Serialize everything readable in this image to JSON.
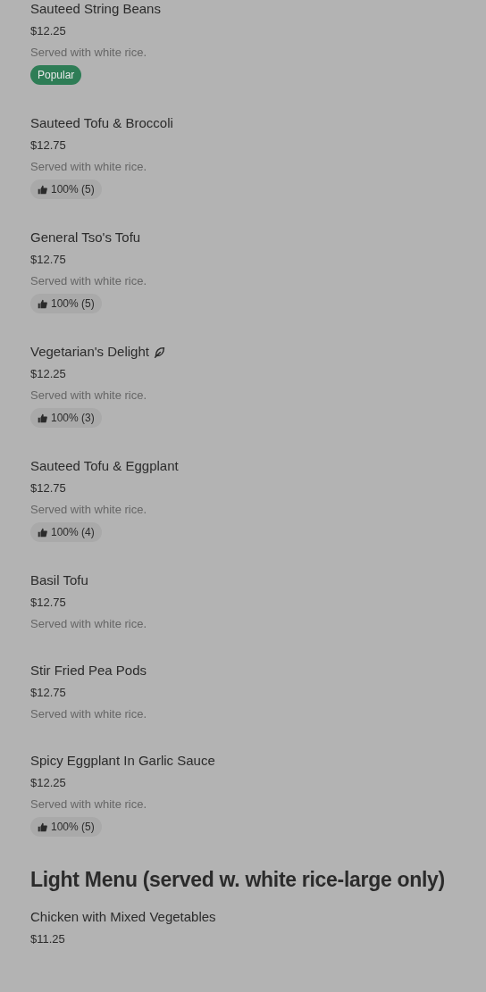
{
  "items": [
    {
      "name": "Sauteed String Beans",
      "vegetarian": false,
      "price": "$12.25",
      "description": "Served with white rice.",
      "badge": {
        "kind": "popular",
        "text": "Popular"
      }
    },
    {
      "name": "Sauteed Tofu & Broccoli",
      "vegetarian": false,
      "price": "$12.75",
      "description": "Served with white rice.",
      "badge": {
        "kind": "rating",
        "text": "100% (5)"
      }
    },
    {
      "name": "General Tso's Tofu",
      "vegetarian": false,
      "price": "$12.75",
      "description": "Served with white rice.",
      "badge": {
        "kind": "rating",
        "text": "100% (5)"
      }
    },
    {
      "name": "Vegetarian's Delight",
      "vegetarian": true,
      "price": "$12.25",
      "description": "Served with white rice.",
      "badge": {
        "kind": "rating",
        "text": "100% (3)"
      }
    },
    {
      "name": "Sauteed Tofu & Eggplant",
      "vegetarian": false,
      "price": "$12.75",
      "description": "Served with white rice.",
      "badge": {
        "kind": "rating",
        "text": "100% (4)"
      }
    },
    {
      "name": "Basil Tofu",
      "vegetarian": false,
      "price": "$12.75",
      "description": "Served with white rice."
    },
    {
      "name": "Stir Fried Pea Pods",
      "vegetarian": false,
      "price": "$12.75",
      "description": "Served with white rice."
    },
    {
      "name": "Spicy Eggplant In Garlic Sauce",
      "vegetarian": false,
      "price": "$12.25",
      "description": "Served with white rice.",
      "badge": {
        "kind": "rating",
        "text": "100% (5)"
      }
    }
  ],
  "section": {
    "title": "Light Menu (served w. white rice-large only)",
    "items": [
      {
        "name": "Chicken with Mixed Vegetables",
        "vegetarian": false,
        "price": "$11.25"
      }
    ]
  }
}
